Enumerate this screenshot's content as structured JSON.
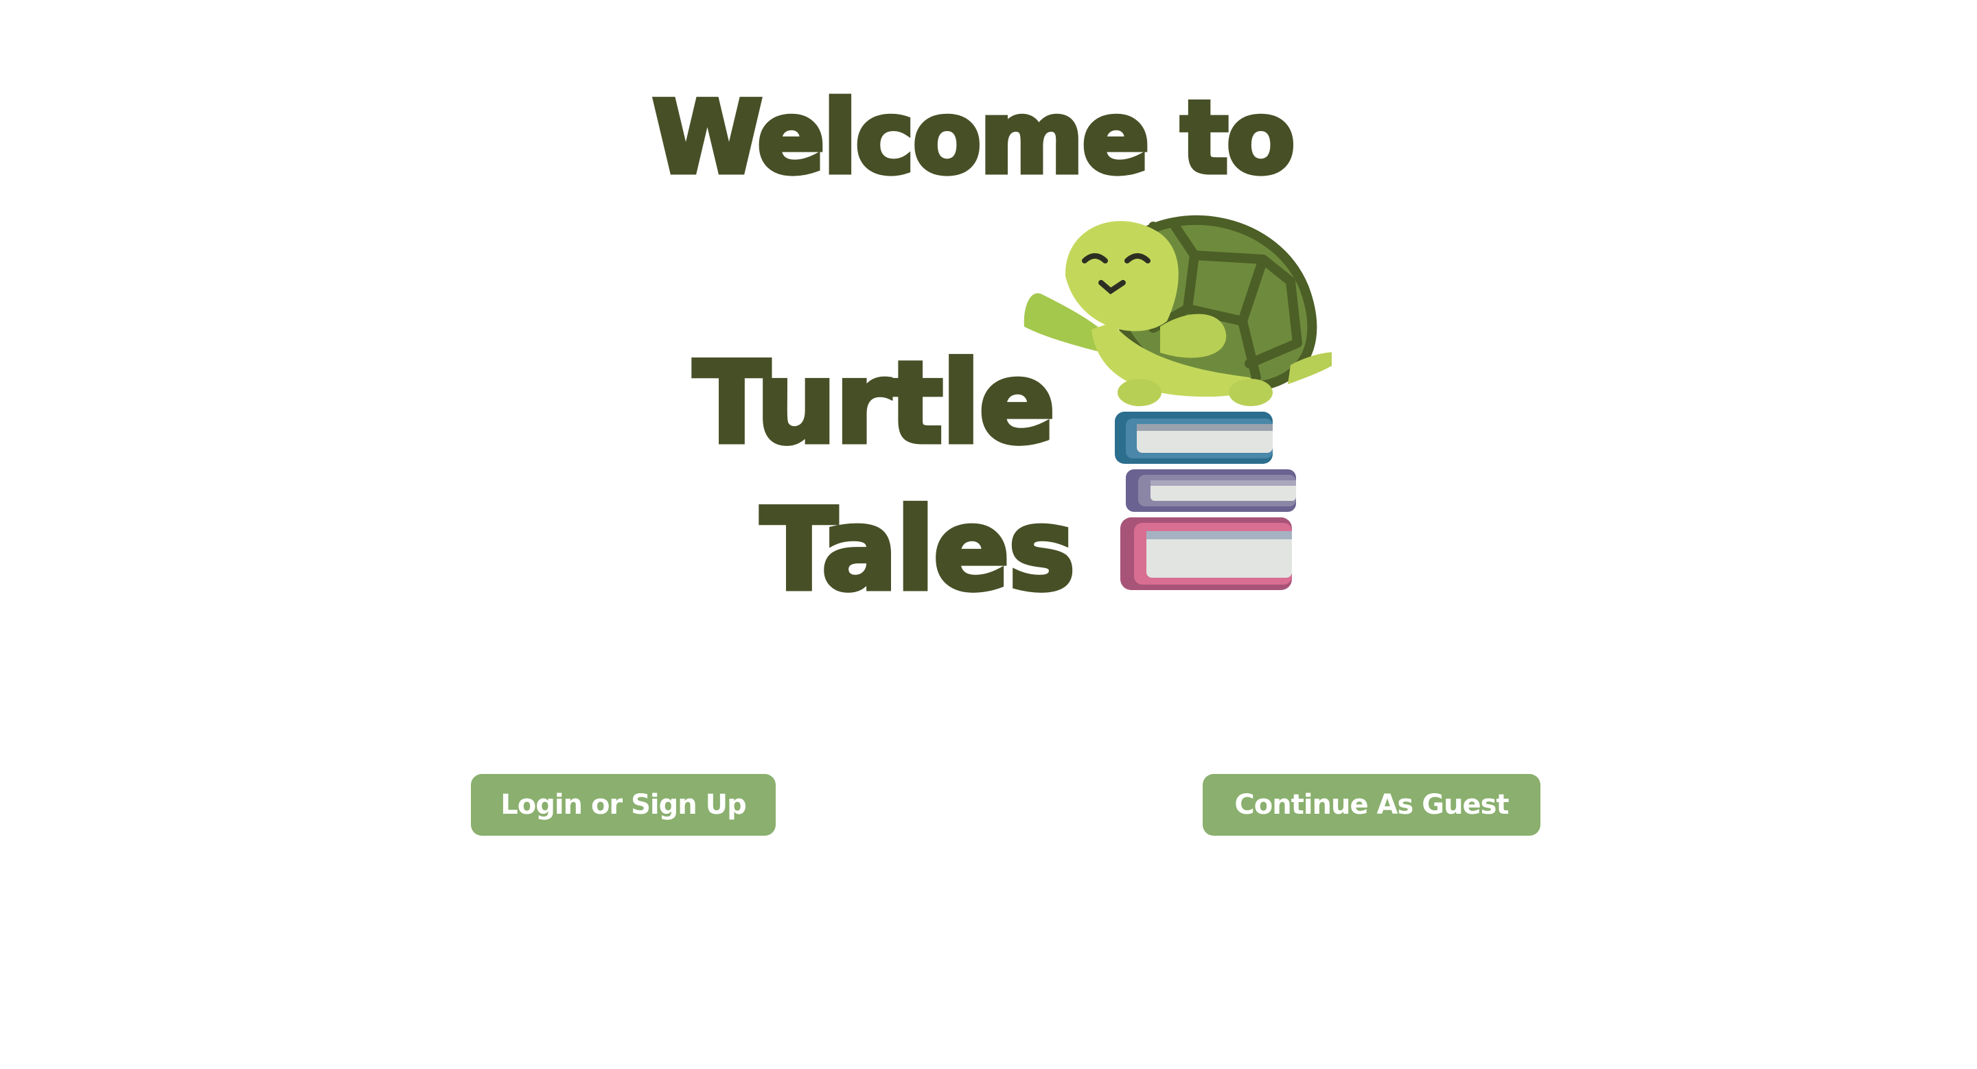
{
  "hero": {
    "title_line1": "Welcome to",
    "title_line2": "Turtle",
    "title_line3": "Tales",
    "title_color": "#474f26"
  },
  "illustration": {
    "icon": "turtle-on-books-icon"
  },
  "actions": {
    "login_label": "Login or Sign Up",
    "guest_label": "Continue As Guest",
    "button_color": "#8aaf6e",
    "label_color": "#ffffff"
  }
}
